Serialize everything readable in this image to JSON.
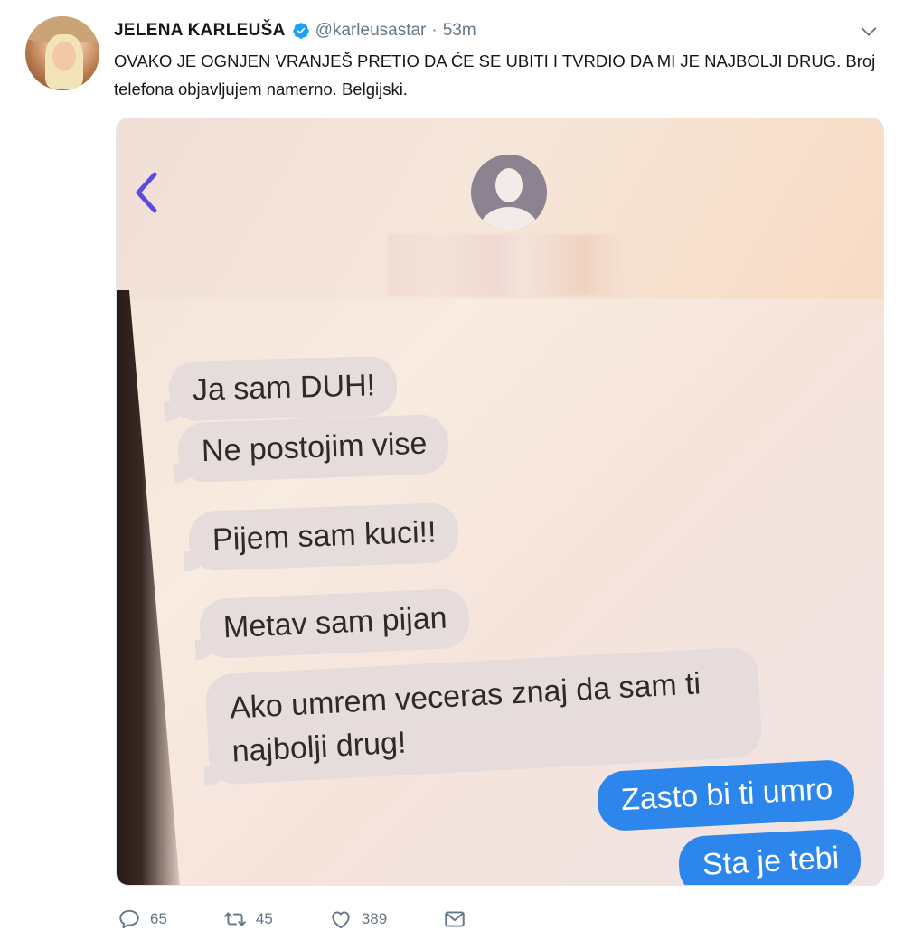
{
  "tweet": {
    "author_name": "JELENA KARLEUŠA",
    "handle": "@karleusastar",
    "separator": "·",
    "time": "53m",
    "text": "OVAKO JE OGNJEN VRANJEŠ PRETIO DA ĆE SE UBITI I TVRDIO DA MI JE NAJBOLJI DRUG. Broj telefona objavljujem namerno. Belgijski."
  },
  "screenshot": {
    "incoming_messages": [
      "Ja sam DUH!",
      "Ne postojim vise",
      "Pijem sam kuci!!",
      "Metav sam pijan",
      "Ako umrem veceras znaj da sam ti najbolji drug!"
    ],
    "outgoing_messages": [
      "Zasto bi ti umro",
      "Sta je tebi"
    ]
  },
  "actions": {
    "replies": "65",
    "retweets": "45",
    "likes": "389"
  },
  "colors": {
    "verified_blue": "#1da1f2",
    "muted_text": "#657786",
    "imessage_blue": "#2d86eb",
    "ios_back_purple": "#5b4be3"
  },
  "icons": {
    "verified": "verified-badge-icon",
    "menu": "chevron-down-icon",
    "back": "back-chevron-icon",
    "contact": "contact-avatar-icon",
    "reply": "reply-icon",
    "retweet": "retweet-icon",
    "like": "heart-icon",
    "dm": "envelope-icon"
  }
}
